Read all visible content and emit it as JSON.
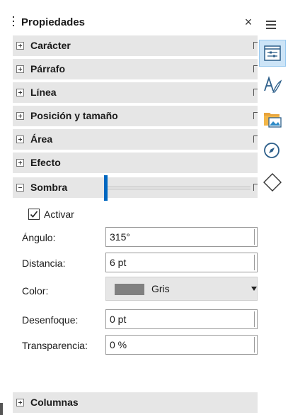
{
  "panel": {
    "title": "Propiedades",
    "close_glyph": "×"
  },
  "sections": [
    {
      "label": "Carácter",
      "expanded": false
    },
    {
      "label": "Párrafo",
      "expanded": false
    },
    {
      "label": "Línea",
      "expanded": false
    },
    {
      "label": "Posición y tamaño",
      "expanded": false
    },
    {
      "label": "Área",
      "expanded": false
    },
    {
      "label": "Efecto",
      "expanded": false
    },
    {
      "label": "Sombra",
      "expanded": true
    }
  ],
  "sombra": {
    "activar_label": "Activar",
    "activar_checked": true,
    "angle_label": "Ángulo:",
    "angle_value": "315°",
    "distance_label": "Distancia:",
    "distance_value": "6 pt",
    "color_label": "Color:",
    "color_value": "Gris",
    "color_swatch": "#808080",
    "blur_label": "Desenfoque:",
    "blur_value": "0 pt",
    "transparency_label": "Transparencia:",
    "transparency_value": "0 %",
    "transparency_fraction": 0
  },
  "columnas": {
    "label": "Columnas",
    "expanded": false
  },
  "tabbar": {
    "icons": [
      "hamburger-menu-icon",
      "properties-icon",
      "styles-icon",
      "gallery-icon",
      "navigator-icon",
      "shapes-icon"
    ],
    "active": "properties-icon",
    "accent": "#0067c0"
  }
}
